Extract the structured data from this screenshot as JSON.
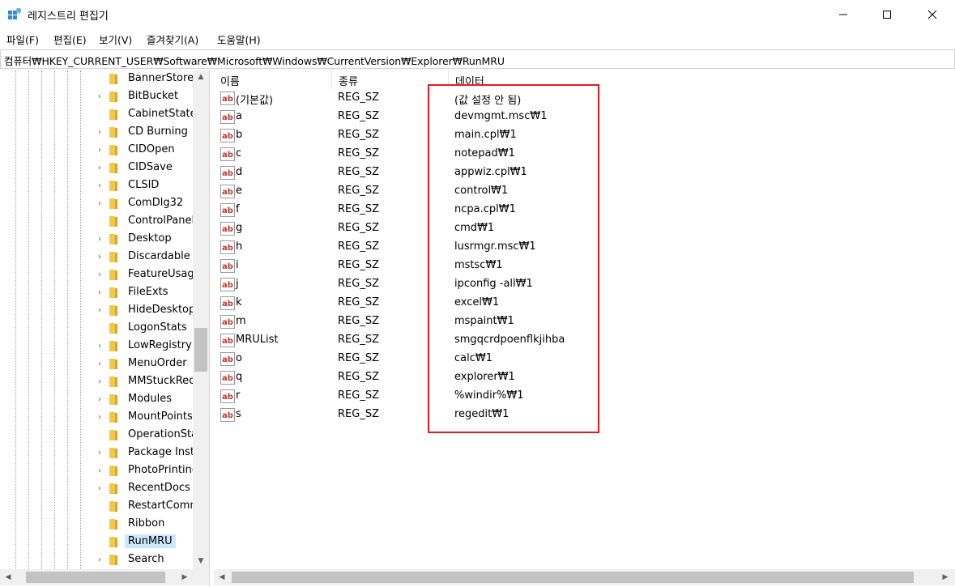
{
  "window": {
    "title": "레지스트리 편집기"
  },
  "menu": [
    {
      "label": "파일(F)"
    },
    {
      "label": "편집(E)"
    },
    {
      "label": "보기(V)"
    },
    {
      "label": "즐겨찾기(A)"
    },
    {
      "label": "도움말(H)"
    }
  ],
  "address": {
    "path": "컴퓨터₩HKEY_CURRENT_USER₩Software₩Microsoft₩Windows₩CurrentVersion₩Explorer₩RunMRU"
  },
  "tree": {
    "items": [
      {
        "label": "BannerStore",
        "expandable": false,
        "selected": false
      },
      {
        "label": "BitBucket",
        "expandable": true,
        "selected": false
      },
      {
        "label": "CabinetState",
        "expandable": false,
        "selected": false
      },
      {
        "label": "CD Burning",
        "expandable": true,
        "selected": false
      },
      {
        "label": "CIDOpen",
        "expandable": true,
        "selected": false
      },
      {
        "label": "CIDSave",
        "expandable": true,
        "selected": false
      },
      {
        "label": "CLSID",
        "expandable": true,
        "selected": false
      },
      {
        "label": "ComDlg32",
        "expandable": true,
        "selected": false
      },
      {
        "label": "ControlPanel",
        "expandable": false,
        "selected": false
      },
      {
        "label": "Desktop",
        "expandable": true,
        "selected": false
      },
      {
        "label": "Discardable",
        "expandable": true,
        "selected": false
      },
      {
        "label": "FeatureUsage",
        "expandable": true,
        "selected": false
      },
      {
        "label": "FileExts",
        "expandable": true,
        "selected": false
      },
      {
        "label": "HideDesktop",
        "expandable": true,
        "selected": false
      },
      {
        "label": "LogonStats",
        "expandable": false,
        "selected": false
      },
      {
        "label": "LowRegistry",
        "expandable": true,
        "selected": false
      },
      {
        "label": "MenuOrder",
        "expandable": true,
        "selected": false
      },
      {
        "label": "MMStuckRec",
        "expandable": true,
        "selected": false
      },
      {
        "label": "Modules",
        "expandable": true,
        "selected": false
      },
      {
        "label": "MountPoints",
        "expandable": true,
        "selected": false
      },
      {
        "label": "OperationSta",
        "expandable": false,
        "selected": false
      },
      {
        "label": "Package Inst",
        "expandable": true,
        "selected": false
      },
      {
        "label": "PhotoPrinting",
        "expandable": true,
        "selected": false
      },
      {
        "label": "RecentDocs",
        "expandable": true,
        "selected": false
      },
      {
        "label": "RestartComm",
        "expandable": false,
        "selected": false
      },
      {
        "label": "Ribbon",
        "expandable": false,
        "selected": false
      },
      {
        "label": "RunMRU",
        "expandable": false,
        "selected": true
      },
      {
        "label": "Search",
        "expandable": true,
        "selected": false
      }
    ]
  },
  "list": {
    "columns": {
      "name": "이름",
      "type": "종류",
      "data": "데이터"
    },
    "rows": [
      {
        "name": "(기본값)",
        "type": "REG_SZ",
        "data": "(값 설정 안 됨)"
      },
      {
        "name": "a",
        "type": "REG_SZ",
        "data": "devmgmt.msc₩1"
      },
      {
        "name": "b",
        "type": "REG_SZ",
        "data": "main.cpl₩1"
      },
      {
        "name": "c",
        "type": "REG_SZ",
        "data": "notepad₩1"
      },
      {
        "name": "d",
        "type": "REG_SZ",
        "data": "appwiz.cpl₩1"
      },
      {
        "name": "e",
        "type": "REG_SZ",
        "data": "control₩1"
      },
      {
        "name": "f",
        "type": "REG_SZ",
        "data": "ncpa.cpl₩1"
      },
      {
        "name": "g",
        "type": "REG_SZ",
        "data": "cmd₩1"
      },
      {
        "name": "h",
        "type": "REG_SZ",
        "data": "lusrmgr.msc₩1"
      },
      {
        "name": "i",
        "type": "REG_SZ",
        "data": "mstsc₩1"
      },
      {
        "name": "j",
        "type": "REG_SZ",
        "data": "ipconfig -all₩1"
      },
      {
        "name": "k",
        "type": "REG_SZ",
        "data": "excel₩1"
      },
      {
        "name": "m",
        "type": "REG_SZ",
        "data": "mspaint₩1"
      },
      {
        "name": "MRUList",
        "type": "REG_SZ",
        "data": "smgqcrdpoenflkjihba"
      },
      {
        "name": "o",
        "type": "REG_SZ",
        "data": "calc₩1"
      },
      {
        "name": "q",
        "type": "REG_SZ",
        "data": "explorer₩1"
      },
      {
        "name": "r",
        "type": "REG_SZ",
        "data": "%windir%₩1"
      },
      {
        "name": "s",
        "type": "REG_SZ",
        "data": "regedit₩1"
      }
    ]
  },
  "colors": {
    "highlight_box": "#e01b24",
    "selection": "#cce8ff",
    "folder": "#f0c94a"
  }
}
